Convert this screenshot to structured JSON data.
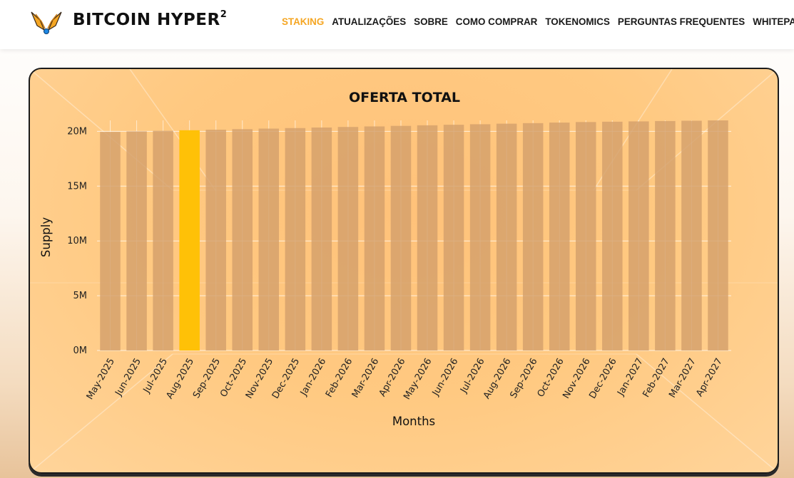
{
  "header": {
    "brand": "BITCOIN HYPER",
    "brand_sup": "2",
    "nav": [
      {
        "label": "STAKING",
        "active": true
      },
      {
        "label": "ATUALIZAÇÕES",
        "active": false
      },
      {
        "label": "SOBRE",
        "active": false
      },
      {
        "label": "COMO COMPRAR",
        "active": false
      },
      {
        "label": "TOKENOMICS",
        "active": false
      },
      {
        "label": "PERGUNTAS FREQUENTES",
        "active": false
      },
      {
        "label": "WHITEPAPER",
        "active": false
      }
    ]
  },
  "colors": {
    "accent": "#f5a623",
    "bar": "#d4a06b",
    "bar_highlight": "#ffc107"
  },
  "chart_data": {
    "type": "bar",
    "title": "OFERTA TOTAL",
    "xlabel": "Months",
    "ylabel": "Supply",
    "ylim": [
      0,
      21000000
    ],
    "yticks": [
      0,
      5000000,
      10000000,
      15000000,
      20000000
    ],
    "ytick_labels": [
      "0M",
      "5M",
      "10M",
      "15M",
      "20M"
    ],
    "grid": true,
    "highlight_category": "Aug-2025",
    "categories": [
      "May-2025",
      "Jun-2025",
      "Jul-2025",
      "Aug-2025",
      "Sep-2025",
      "Oct-2025",
      "Nov-2025",
      "Dec-2025",
      "Jan-2026",
      "Feb-2026",
      "Mar-2026",
      "Apr-2026",
      "May-2026",
      "Jun-2026",
      "Jul-2026",
      "Aug-2026",
      "Sep-2026",
      "Oct-2026",
      "Nov-2026",
      "Dec-2026",
      "Jan-2027",
      "Feb-2027",
      "Mar-2027",
      "Apr-2027"
    ],
    "values": [
      19950000,
      20000000,
      20050000,
      20100000,
      20150000,
      20200000,
      20250000,
      20300000,
      20350000,
      20400000,
      20450000,
      20500000,
      20550000,
      20600000,
      20650000,
      20700000,
      20750000,
      20800000,
      20850000,
      20880000,
      20910000,
      20940000,
      20970000,
      21000000
    ]
  }
}
